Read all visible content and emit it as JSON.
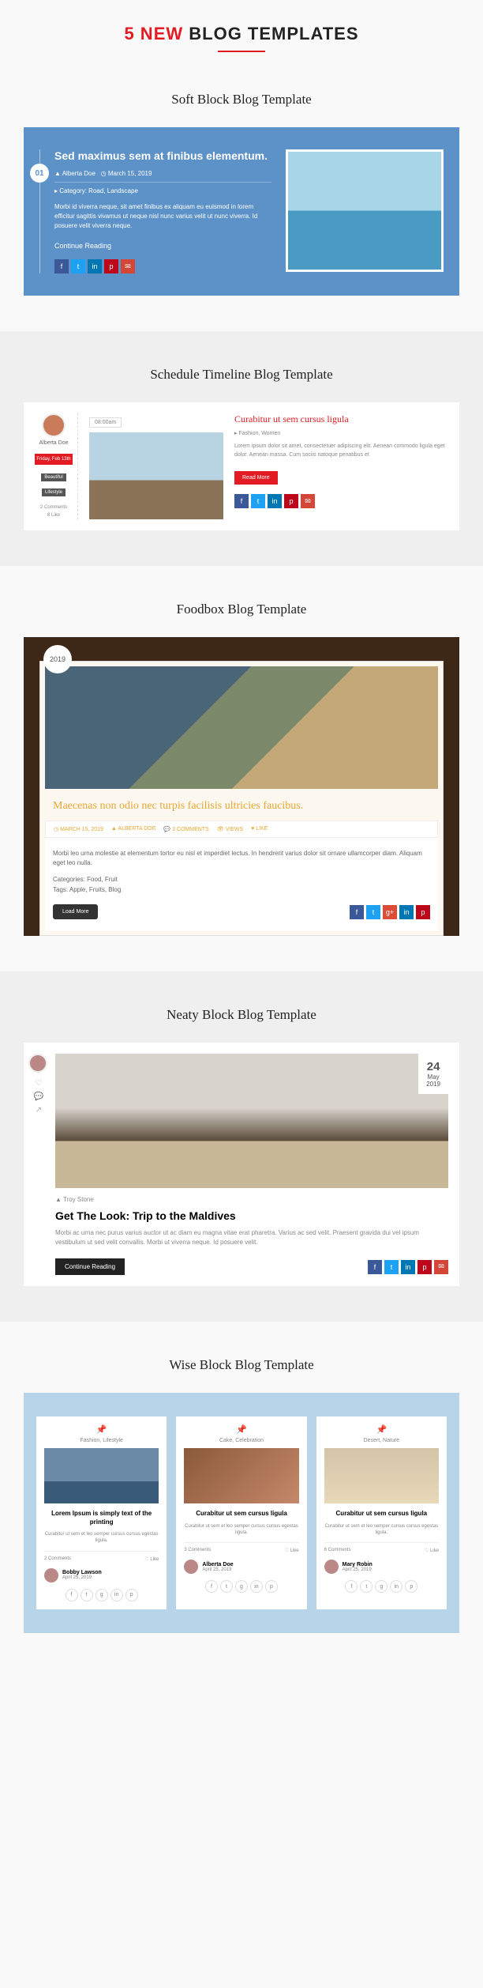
{
  "header": {
    "prefix": "5 NEW",
    "suffix": "BLOG TEMPLATES"
  },
  "t1": {
    "name": "Soft Block Blog Template",
    "num": "01",
    "title": "Sed maximus sem at finibus elementum.",
    "author": "Alberta Doe",
    "date": "March 15, 2019",
    "catLabel": "Category:",
    "cats": "Road, Landscape",
    "body": "Morbi id viverra neque, sit amet finibus ex aliquam eu euismod in lorem efficitur sagittis vivamus ut neque nisl nunc varius velit ut nunc viverra. Id posuere velit viverra neque.",
    "read": "Continue Reading"
  },
  "t2": {
    "name": "Schedule Timeline Blog Template",
    "author": "Alberta Doe",
    "date": "Friday, Feb 13th",
    "tag1": "Beautiful",
    "tag2": "Lifestyle",
    "comments": "2 Comments",
    "likes": "8 Like",
    "time": "08:00am",
    "title": "Curabitur ut sem cursus ligula",
    "meta": "Fashion, Women",
    "body": "Lorem ipsum dolor sit amet, consectetuer adipiscing elit. Aenean commodo ligula eget dolor. Aenean massa. Cum sociis natoque penatibus et",
    "btn": "Read More"
  },
  "t3": {
    "name": "Foodbox Blog Template",
    "year": "2019",
    "title": "Maecenas non odio nec turpis facilisis ultricies faucibus.",
    "m1": "MARCH 15, 2019",
    "m2": "ALBERTA DOE",
    "m3": "3 COMMENTS",
    "m4": "VIEWS",
    "m5": "LIKE",
    "body": "Morbi leo urna molestie at elementum tortor eu nisl et imperdiet lectus. In hendrerit varius dolor sit ornare ullamcorper diam. Aliquam eget leo nulla.",
    "catsL": "Categories:",
    "cats": "Food, Fruit",
    "tagsL": "Tags:",
    "tags": "Apple, Fruits, Blog",
    "btn": "Load More"
  },
  "t4": {
    "name": "Neaty Block Blog Template",
    "day": "24",
    "month": "May",
    "year": "2019",
    "author": "Troy Stone",
    "title": "Get The Look: Trip to the Maldives",
    "body": "Morbi ac urna nec purus varius auctor ut ac diam eu magna vitae erat pharetra. Varius ac sed velit. Praesent gravida dui vel ipsum vestibulum ut sed velit convallis. Morbi ut viverra neque. Id posuere velit.",
    "btn": "Continue Reading"
  },
  "t5": {
    "name": "Wise Block Blog Template",
    "cards": [
      {
        "cat": "Fashion, Lifestyle",
        "title": "Lorem Ipsum is simply text of the printing",
        "body": "Curabitur ut sem et leo semper cursus cursus egestas ligula.",
        "comments": "2 Comments",
        "likes": "Like",
        "author": "Bobby Lawson",
        "date": "April 25, 2019"
      },
      {
        "cat": "Cake, Celebration",
        "title": "Curabitur ut sem cursus ligula",
        "body": "Curabitur ut sem et leo semper cursus cursus egestas ligula.",
        "comments": "3 Comments",
        "likes": "Like",
        "author": "Alberta Doe",
        "date": "April 25, 2019"
      },
      {
        "cat": "Desert, Nature",
        "title": "Curabitur ut sem cursus ligula",
        "body": "Curabitur ut sem et leo semper cursus cursus egestas ligula.",
        "comments": "6 Comments",
        "likes": "Like",
        "author": "Mary Robin",
        "date": "April 25, 2019"
      }
    ]
  }
}
